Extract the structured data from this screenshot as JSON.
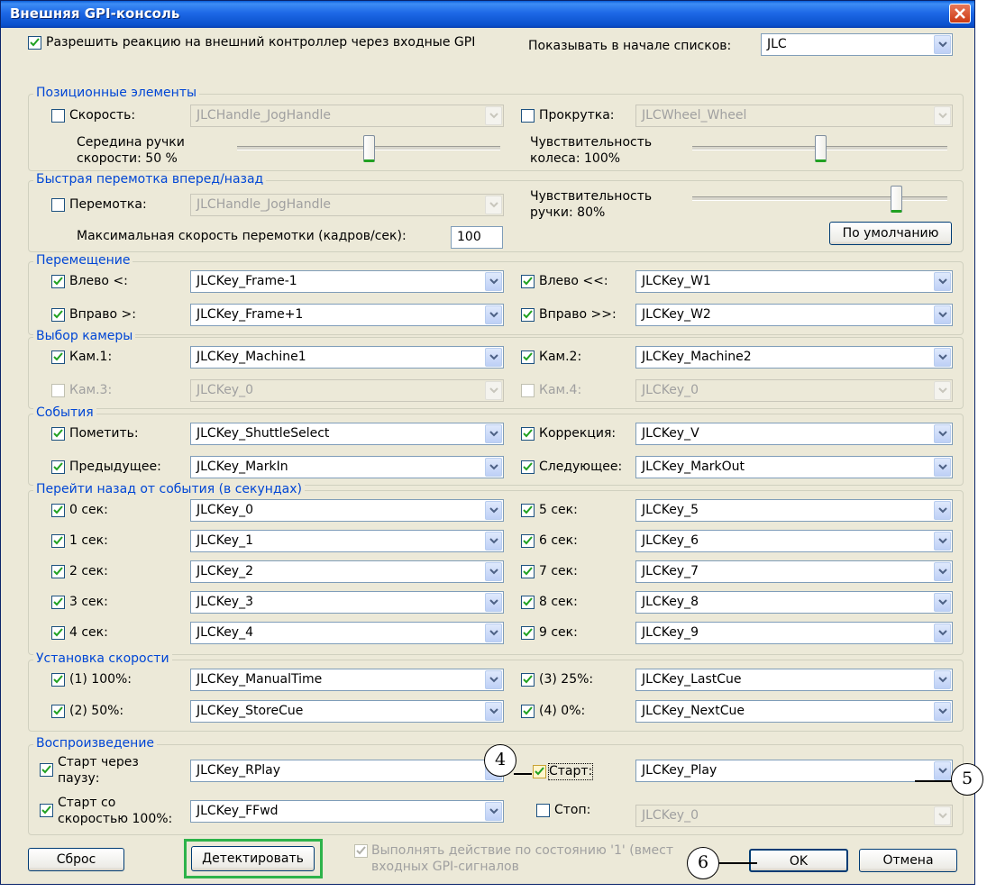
{
  "window": {
    "title": "Внешняя GPI-консоль"
  },
  "top": {
    "enable_label": "Разрешить реакцию на внешний контроллер через входные GPI",
    "show_first_label": "Показывать в начале списков:",
    "show_first_value": "JLC"
  },
  "positional": {
    "title": "Позиционные элементы",
    "speed_label": "Скорость:",
    "speed_value": "JLCHandle_JogHandle",
    "scroll_label": "Прокрутка:",
    "scroll_value": "JLCWheel_Wheel",
    "handle_mid_line1": "Середина ручки",
    "handle_mid_line2": "скорости: 50 %",
    "handle_mid_level": 0.5,
    "wheel_sens_line1": "Чувствительность",
    "wheel_sens_line2": "колеса: 100%",
    "wheel_sens_level": 0.5
  },
  "rewind": {
    "title": "Быстрая перемотка вперед/назад",
    "rewind_label": "Перемотка:",
    "rewind_value": "JLCHandle_JogHandle",
    "max_speed_label": "Максимальная скорость перемотки (кадров/сек):",
    "max_speed_value": "100",
    "handle_sens_line1": "Чувствительность",
    "handle_sens_line2": "ручки: 80%",
    "handle_sens_level": 0.8,
    "default_button": "По умолчанию"
  },
  "move": {
    "title": "Перемещение",
    "rows": [
      {
        "l_label": "Влево <:",
        "l_value": "JLCKey_Frame-1",
        "r_label": "Влево <<:",
        "r_value": "JLCKey_W1"
      },
      {
        "l_label": "Вправо >:",
        "l_value": "JLCKey_Frame+1",
        "r_label": "Вправо >>:",
        "r_value": "JLCKey_W2"
      }
    ]
  },
  "camera": {
    "title": "Выбор камеры",
    "rows": [
      {
        "l_label": "Кам.1:",
        "l_value": "JLCKey_Machine1",
        "r_label": "Кам.2:",
        "r_value": "JLCKey_Machine2"
      },
      {
        "l_label": "Кам.3:",
        "l_value": "JLCKey_0",
        "r_label": "Кам.4:",
        "r_value": "JLCKey_0"
      }
    ]
  },
  "events": {
    "title": "События",
    "rows": [
      {
        "l_label": "Пометить:",
        "l_value": "JLCKey_ShuttleSelect",
        "r_label": "Коррекция:",
        "r_value": "JLCKey_V"
      },
      {
        "l_label": "Предыдущее:",
        "l_value": "JLCKey_MarkIn",
        "r_label": "Следующее:",
        "r_value": "JLCKey_MarkOut"
      }
    ]
  },
  "goback": {
    "title": "Перейти назад от события (в секундах)",
    "rows": [
      {
        "l_label": "0 сек:",
        "l_value": "JLCKey_0",
        "r_label": "5 сек:",
        "r_value": "JLCKey_5"
      },
      {
        "l_label": "1 сек:",
        "l_value": "JLCKey_1",
        "r_label": "6 сек:",
        "r_value": "JLCKey_6"
      },
      {
        "l_label": "2 сек:",
        "l_value": "JLCKey_2",
        "r_label": "7 сек:",
        "r_value": "JLCKey_7"
      },
      {
        "l_label": "3 сек:",
        "l_value": "JLCKey_3",
        "r_label": "8 сек:",
        "r_value": "JLCKey_8"
      },
      {
        "l_label": "4 сек:",
        "l_value": "JLCKey_4",
        "r_label": "9 сек:",
        "r_value": "JLCKey_9"
      }
    ]
  },
  "speedset": {
    "title": "Установка скорости",
    "rows": [
      {
        "l_label": "(1) 100%:",
        "l_value": "JLCKey_ManualTime",
        "r_label": "(3) 25%:",
        "r_value": "JLCKey_LastCue"
      },
      {
        "l_label": "(2) 50%:",
        "l_value": "JLCKey_StoreCue",
        "r_label": "(4) 0%:",
        "r_value": "JLCKey_NextCue"
      }
    ]
  },
  "playback": {
    "title": "Воспроизведение",
    "pause_start_line1": "Старт через",
    "pause_start_line2": "паузу:",
    "pause_start_value": "JLCKey_RPlay",
    "speed_start_line1": "Старт со",
    "speed_start_line2": "скоростью 100%:",
    "speed_start_value": "JLCKey_FFwd",
    "start_label": "Старт:",
    "start_value": "JLCKey_Play",
    "stop_label": "Стоп:",
    "stop_value": "JLCKey_0"
  },
  "bottom": {
    "reset_button": "Сброс",
    "detect_button": "Детектировать",
    "exec_line1": "Выполнять действие по состоянию '1' (вмест",
    "exec_line2": "входных GPI-сигналов",
    "ok_button": "OK",
    "cancel_button": "Отмена"
  },
  "callouts": {
    "c4": "4",
    "c5": "5",
    "c6": "6"
  },
  "colors": {
    "group_title": "#0046d5",
    "highlight": "#2db34a",
    "titlebar": "#0a50cc"
  }
}
